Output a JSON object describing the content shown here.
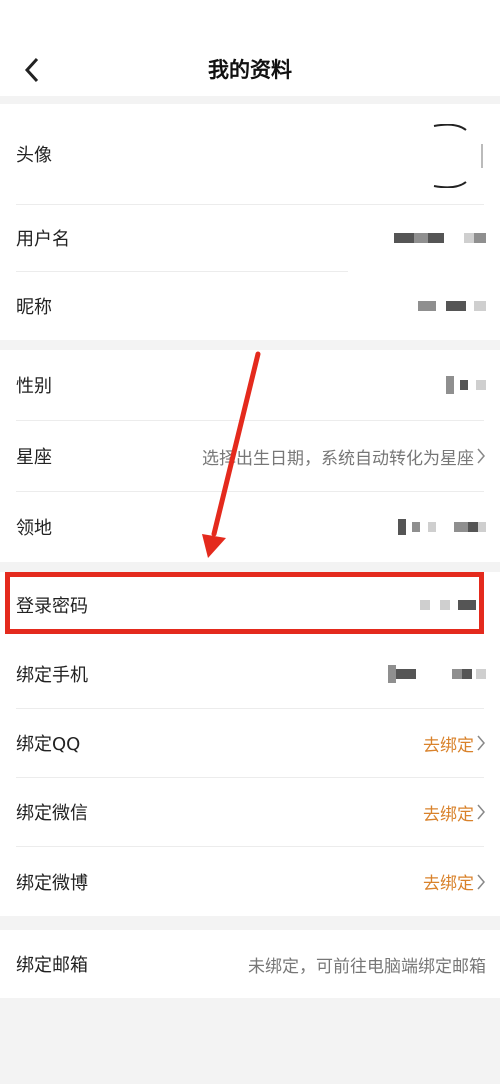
{
  "header": {
    "title": "我的资料"
  },
  "rows": {
    "avatar": "头像",
    "username": "用户名",
    "nickname": "昵称",
    "gender": "性别",
    "zodiac": "星座",
    "territory": "领地",
    "password": "登录密码",
    "phone": "绑定手机",
    "qq": "绑定QQ",
    "wechat": "绑定微信",
    "weibo": "绑定微博",
    "email": "绑定邮箱"
  },
  "values": {
    "zodiac_hint": "选择出生日期，系统自动转化为星座",
    "qq_action": "去绑定",
    "wechat_action": "去绑定",
    "weibo_action": "去绑定",
    "email_hint": "未绑定，可前往电脑端绑定邮箱"
  },
  "colors": {
    "accent": "#d9822b",
    "highlight": "#e42a1d",
    "background": "#f3f3f3"
  }
}
